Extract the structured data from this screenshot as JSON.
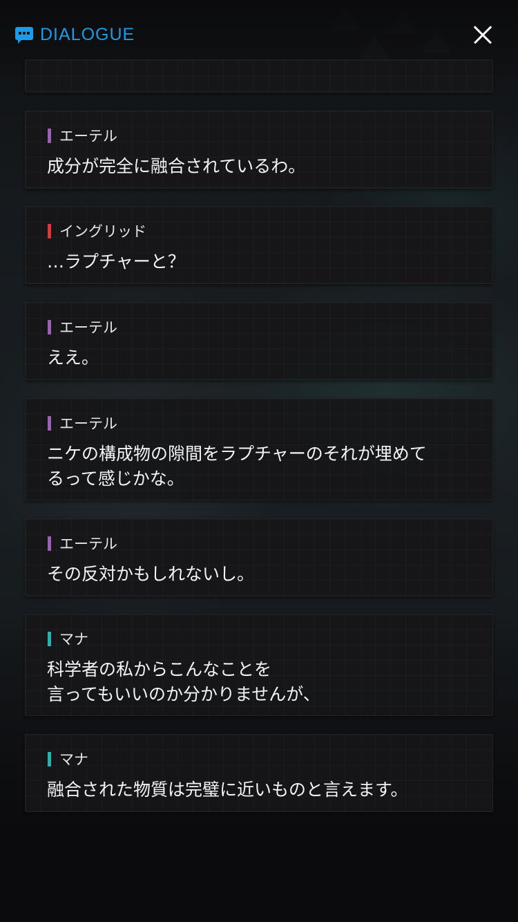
{
  "header": {
    "title": "DIALOGUE"
  },
  "colors": {
    "accent": "#1e9be8",
    "speaker_ether": "#9b5fb5",
    "speaker_ingrid": "#e0363b",
    "speaker_mana": "#22b5b0"
  },
  "icons": {
    "title_icon": "chat-bubble-icon",
    "close": "close-icon"
  },
  "dialogue": [
    {
      "speaker": "エーテル",
      "color": "#9b5fb5",
      "text": "成分が完全に融合されているわ。"
    },
    {
      "speaker": "イングリッド",
      "color": "#e0363b",
      "text": "…ラプチャーと？"
    },
    {
      "speaker": "エーテル",
      "color": "#9b5fb5",
      "text": "ええ。"
    },
    {
      "speaker": "エーテル",
      "color": "#9b5fb5",
      "text": "ニケの構成物の隙間をラプチャーのそれが埋めて\nるって感じかな。"
    },
    {
      "speaker": "エーテル",
      "color": "#9b5fb5",
      "text": "その反対かもしれないし。"
    },
    {
      "speaker": "マナ",
      "color": "#22b5b0",
      "text": "科学者の私からこんなことを\n言ってもいいのか分かりませんが、"
    },
    {
      "speaker": "マナ",
      "color": "#22b5b0",
      "text": "融合された物質は完璧に近いものと言えます。"
    }
  ]
}
